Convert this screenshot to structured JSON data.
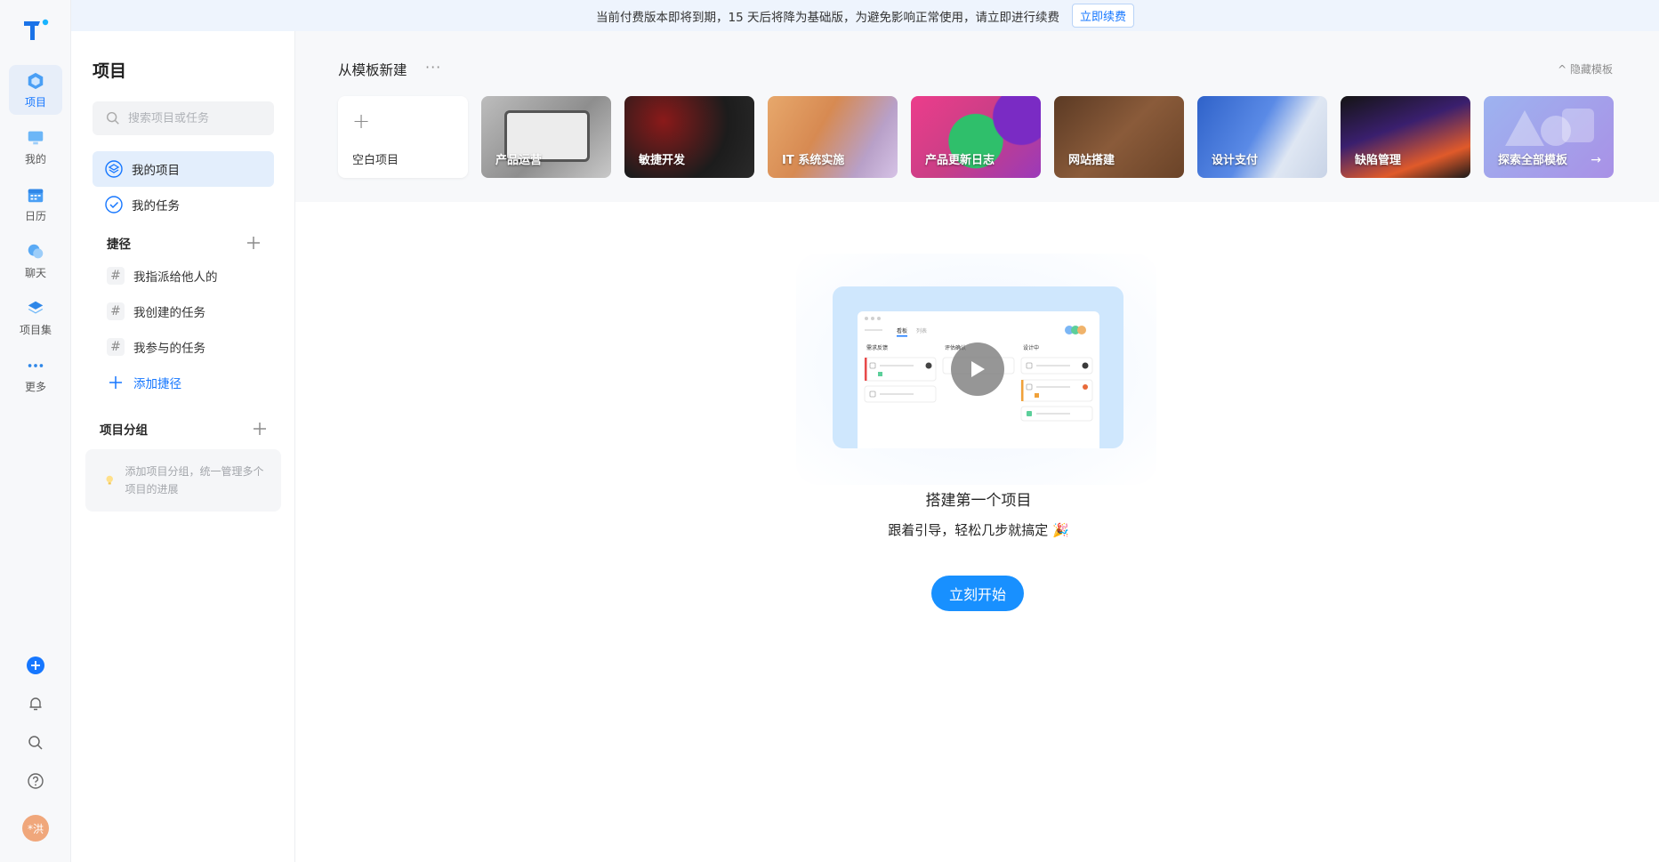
{
  "banner": {
    "message": "当前付费版本即将到期，15 天后将降为基础版，为避免影响正常使用，请立即进行续费",
    "renew_label": "立即续费"
  },
  "rail": {
    "items": [
      {
        "label": "项目",
        "icon": "project-cube-icon",
        "active": true
      },
      {
        "label": "我的",
        "icon": "monitor-icon"
      },
      {
        "label": "日历",
        "icon": "calendar-icon"
      },
      {
        "label": "聊天",
        "icon": "chat-icon"
      },
      {
        "label": "项目集",
        "icon": "layers-icon"
      },
      {
        "label": "更多",
        "icon": "more-dots-icon"
      }
    ],
    "bottom_icons": [
      "add-circle-icon",
      "bell-icon",
      "search-icon",
      "help-icon",
      "avatar"
    ],
    "avatar_text": "*洪",
    "accent": "#1677ff"
  },
  "sidebar": {
    "title": "项目",
    "search_placeholder": "搜索项目或任务",
    "nav": [
      {
        "label": "我的项目",
        "icon": "project-cube-icon",
        "active": true
      },
      {
        "label": "我的任务",
        "icon": "check-circle-icon"
      }
    ],
    "shortcuts_title": "捷径",
    "shortcuts": [
      {
        "label": "我指派给他人的"
      },
      {
        "label": "我创建的任务"
      },
      {
        "label": "我参与的任务"
      }
    ],
    "add_shortcut_label": "添加捷径",
    "groups_title": "项目分组",
    "groups_tip": "添加项目分组，统一管理多个项目的进展"
  },
  "templates": {
    "title": "从模板新建",
    "more": "···",
    "hide_label": "^ 隐藏模板",
    "cards": [
      {
        "label": "空白项目",
        "blank": true
      },
      {
        "label": "产品运营"
      },
      {
        "label": "敏捷开发"
      },
      {
        "label": "IT 系统实施"
      },
      {
        "label": "产品更新日志"
      },
      {
        "label": "网站搭建"
      },
      {
        "label": "设计支付"
      },
      {
        "label": "缺陷管理"
      },
      {
        "label": "探索全部模板"
      }
    ]
  },
  "empty_state": {
    "title": "搭建第一个项目",
    "subtitle": "跟着引导，轻松几步就搞定 🎉",
    "cta_label": "立刻开始",
    "preview": {
      "tabs": [
        "看板",
        "列表"
      ],
      "columns": [
        "需求反馈",
        "评估确认",
        "设计中"
      ]
    }
  }
}
